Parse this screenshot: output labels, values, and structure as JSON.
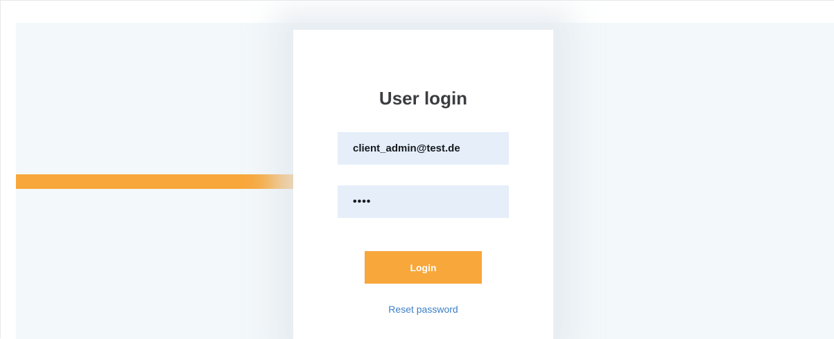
{
  "login": {
    "title": "User login",
    "email_value": "client_admin@test.de",
    "password_value": "••••",
    "login_button_label": "Login",
    "reset_password_label": "Reset password"
  },
  "colors": {
    "accent": "#f8a73a",
    "backdrop": "#f3f8fa",
    "field_background": "#e5eef9",
    "link": "#3c7fc4",
    "title": "#3b3d40"
  }
}
